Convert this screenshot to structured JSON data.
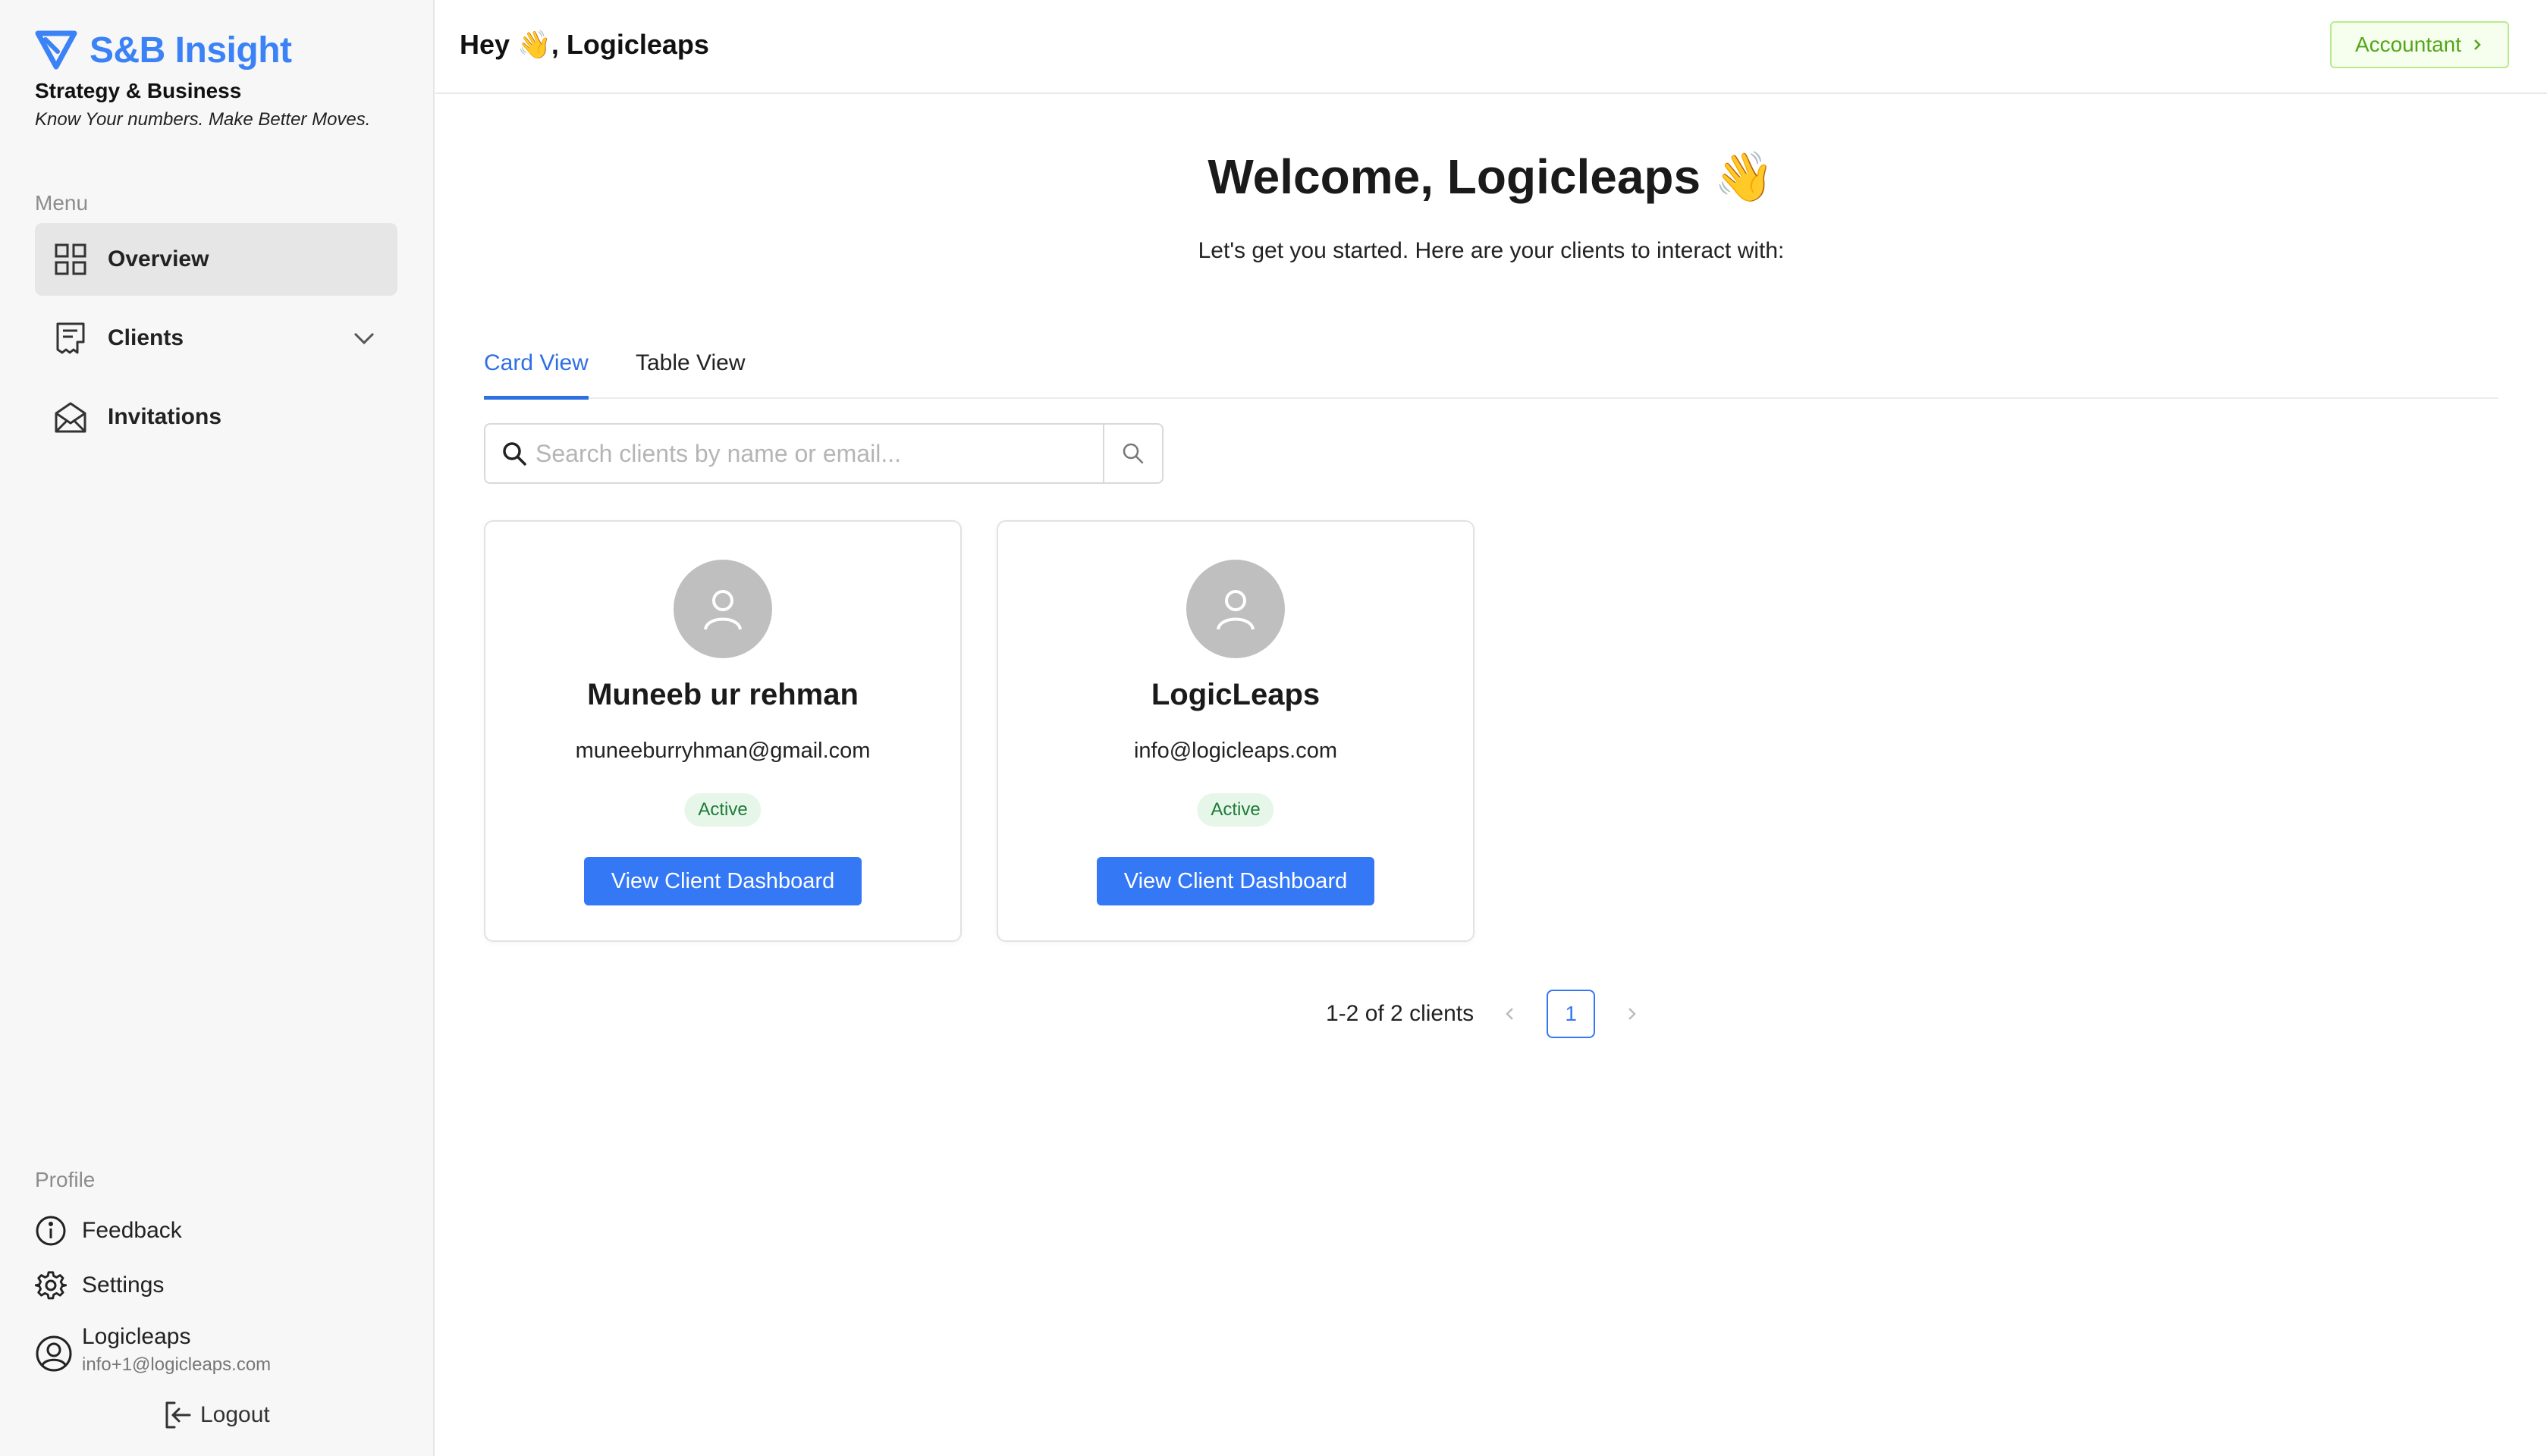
{
  "brand": {
    "name": "S&B Insight",
    "subtitle": "Strategy & Business",
    "tagline": "Know Your numbers. Make Better Moves.",
    "color": "#3b82f6"
  },
  "sidebar": {
    "menu_label": "Menu",
    "items": [
      {
        "label": "Overview",
        "icon": "grid-icon",
        "active": true
      },
      {
        "label": "Clients",
        "icon": "receipt-icon",
        "expandable": true
      },
      {
        "label": "Invitations",
        "icon": "envelope-open-icon"
      }
    ],
    "profile_label": "Profile",
    "profile_items": [
      {
        "label": "Feedback",
        "icon": "info-circle-icon"
      },
      {
        "label": "Settings",
        "icon": "gear-icon"
      }
    ],
    "user": {
      "name": "Logicleaps",
      "email": "info+1@logicleaps.com"
    },
    "logout_label": "Logout"
  },
  "header": {
    "greeting": "Hey 👋, Logicleaps",
    "role_button": "Accountant"
  },
  "main": {
    "title": "Welcome, Logicleaps 👋",
    "subtitle": "Let's get you started. Here are your clients to interact with:",
    "tabs": [
      {
        "label": "Card View",
        "active": true
      },
      {
        "label": "Table View",
        "active": false
      }
    ],
    "search": {
      "placeholder": "Search clients by name or email...",
      "value": ""
    },
    "clients": [
      {
        "name": "Muneeb ur rehman",
        "email": "muneeburryhman@gmail.com",
        "status": "Active",
        "action": "View Client Dashboard"
      },
      {
        "name": "LogicLeaps",
        "email": "info@logicleaps.com",
        "status": "Active",
        "action": "View Client Dashboard"
      }
    ],
    "pagination": {
      "summary": "1-2 of 2 clients",
      "current_page": "1"
    }
  },
  "colors": {
    "accent": "#3478f6",
    "status_active_bg": "#e6f7ea",
    "status_active_text": "#1f7a38",
    "role_button_text": "#52a51a"
  }
}
